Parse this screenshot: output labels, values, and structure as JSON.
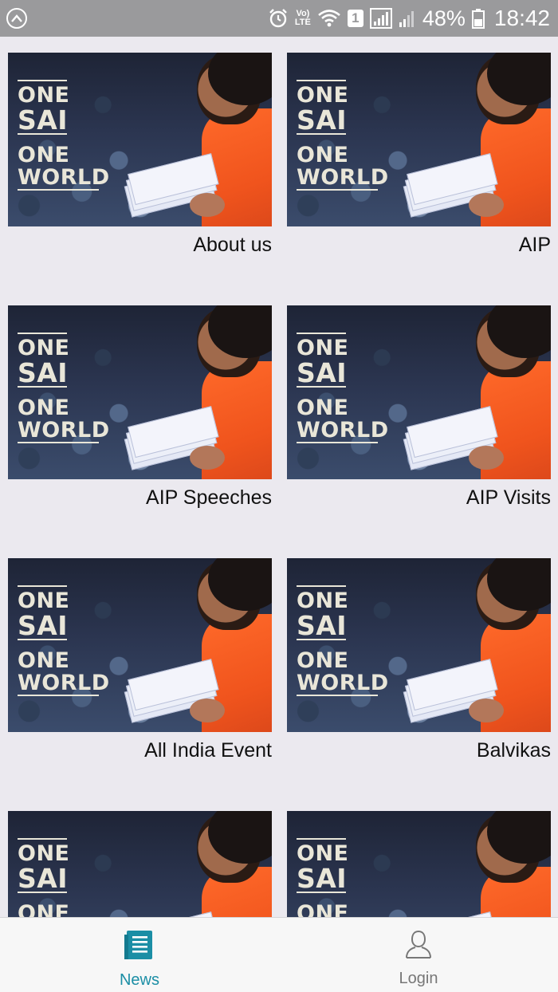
{
  "status_bar": {
    "notification_icon": "caret-up-icon",
    "volte_top": "Vo)",
    "volte_bottom": "LTE",
    "sim_slot": "1",
    "battery": "48%",
    "time": "18:42"
  },
  "logo": {
    "line1": "ONE",
    "line2": "SAI",
    "line3": "ONE",
    "line4": "WORLD"
  },
  "tiles": [
    {
      "label": "About us"
    },
    {
      "label": "AIP"
    },
    {
      "label": "AIP Speeches"
    },
    {
      "label": "AIP Visits"
    },
    {
      "label": "All India Event"
    },
    {
      "label": "Balvikas"
    },
    {
      "label": ""
    },
    {
      "label": ""
    }
  ],
  "bottom_nav": {
    "items": [
      {
        "label": "News",
        "icon": "news-icon",
        "active": true
      },
      {
        "label": "Login",
        "icon": "user-icon",
        "active": false
      }
    ]
  },
  "colors": {
    "accent": "#1b8ea5",
    "status_bar": "#9a9a9c",
    "background": "#ebe9ef",
    "robe": "#f0541d"
  }
}
